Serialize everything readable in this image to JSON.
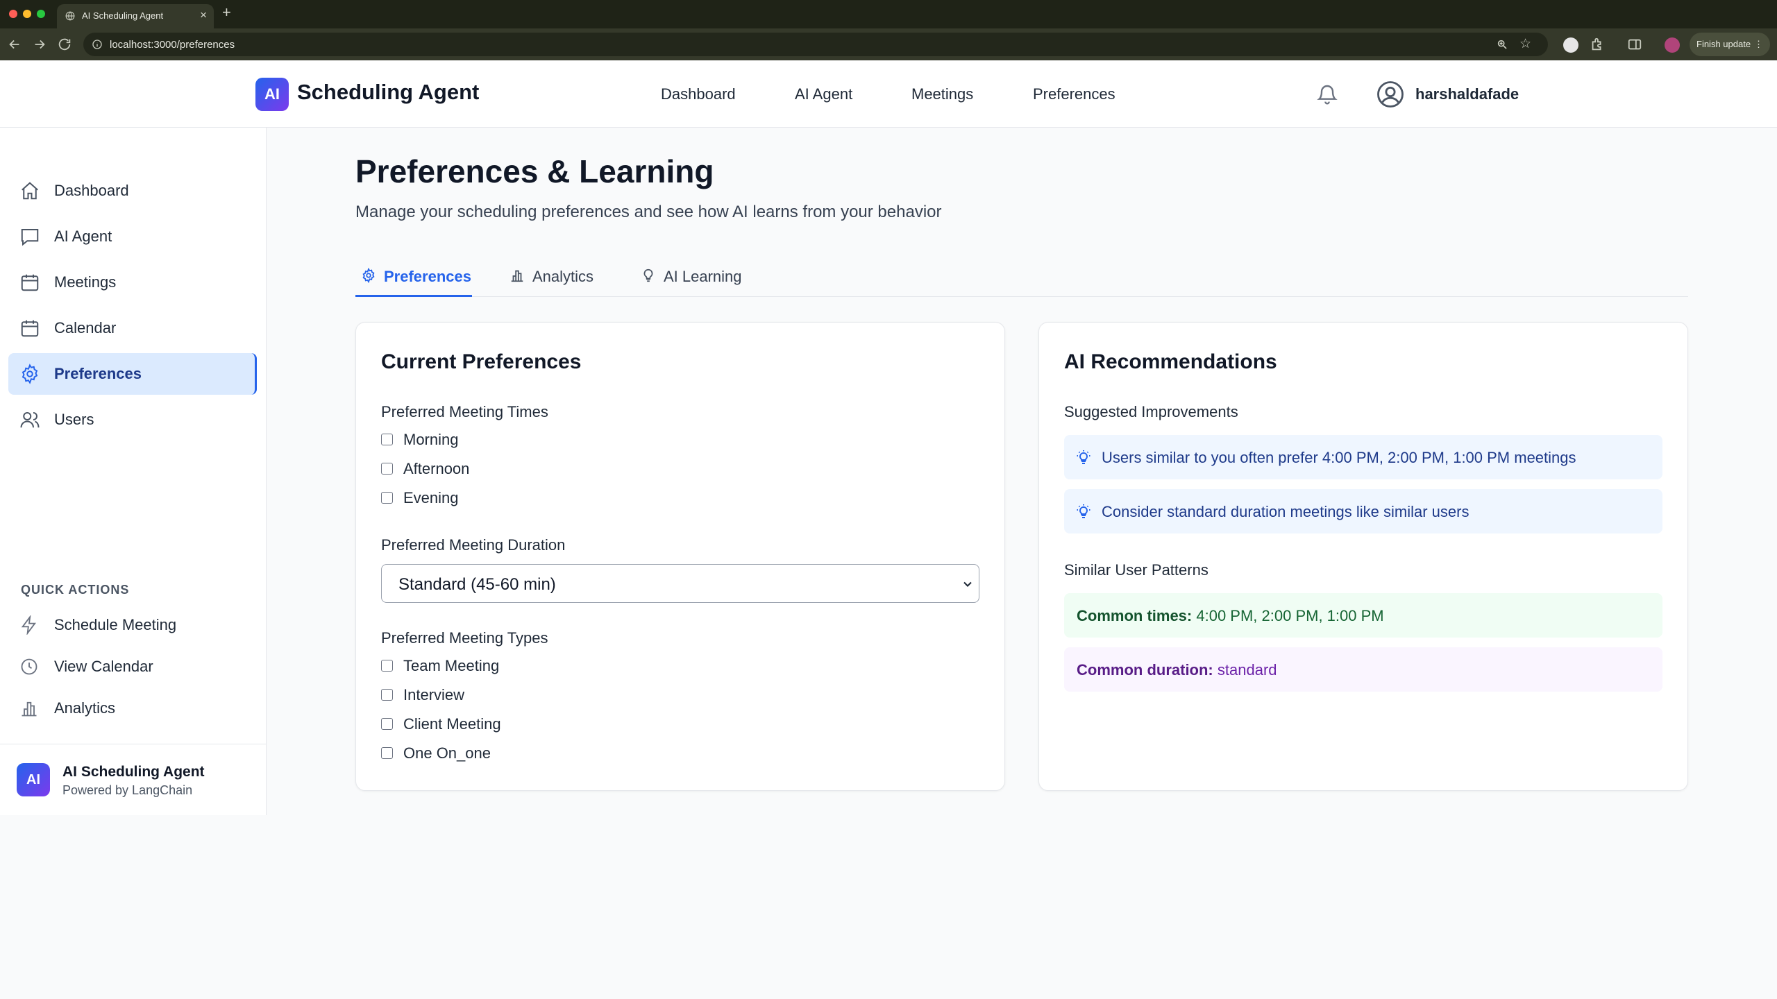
{
  "browser": {
    "tab_title": "AI Scheduling Agent",
    "url": "localhost:3000/preferences",
    "finish_update": "Finish update",
    "colors": {
      "red": "#ff5f57",
      "yellow": "#febc2e",
      "green": "#28c840"
    }
  },
  "header": {
    "logo_text": "AI",
    "brand": "Scheduling Agent",
    "nav": [
      "Dashboard",
      "AI Agent",
      "Meetings",
      "Preferences"
    ],
    "username": "harshaldafade"
  },
  "sidebar": {
    "items": [
      {
        "label": "Dashboard",
        "icon": "home-icon"
      },
      {
        "label": "AI Agent",
        "icon": "chat-icon"
      },
      {
        "label": "Meetings",
        "icon": "calendar-icon"
      },
      {
        "label": "Calendar",
        "icon": "calendar-icon"
      },
      {
        "label": "Preferences",
        "icon": "gear-icon",
        "active": true
      },
      {
        "label": "Users",
        "icon": "users-icon"
      }
    ],
    "quick_actions_title": "QUICK ACTIONS",
    "quick_actions": [
      {
        "label": "Schedule Meeting",
        "icon": "bolt-icon"
      },
      {
        "label": "View Calendar",
        "icon": "clock-icon"
      },
      {
        "label": "Analytics",
        "icon": "bar-chart-icon"
      }
    ],
    "footer": {
      "logo_text": "AI",
      "title": "AI Scheduling Agent",
      "subtitle": "Powered by LangChain"
    }
  },
  "main": {
    "title": "Preferences & Learning",
    "subtitle": "Manage your scheduling preferences and see how AI learns from your behavior",
    "tabs": [
      {
        "label": "Preferences",
        "icon": "gear-icon",
        "active": true
      },
      {
        "label": "Analytics",
        "icon": "bar-chart-icon"
      },
      {
        "label": "AI Learning",
        "icon": "lightbulb-icon"
      }
    ]
  },
  "current_preferences": {
    "title": "Current Preferences",
    "times_label": "Preferred Meeting Times",
    "times": [
      {
        "label": "Morning",
        "checked": false
      },
      {
        "label": "Afternoon",
        "checked": false
      },
      {
        "label": "Evening",
        "checked": false
      }
    ],
    "duration_label": "Preferred Meeting Duration",
    "duration_value": "Standard (45-60 min)",
    "types_label": "Preferred Meeting Types",
    "types": [
      {
        "label": "Team Meeting",
        "checked": false
      },
      {
        "label": "Interview",
        "checked": false
      },
      {
        "label": "Client Meeting",
        "checked": false
      },
      {
        "label": "One On_one",
        "checked": false
      }
    ]
  },
  "ai_recommendations": {
    "title": "AI Recommendations",
    "improvements_label": "Suggested Improvements",
    "improvements": [
      "Users similar to you often prefer 4:00 PM, 2:00 PM, 1:00 PM meetings",
      "Consider standard duration meetings like similar users"
    ],
    "patterns_label": "Similar User Patterns",
    "common_times_key": "Common times:",
    "common_times_value": "4:00 PM, 2:00 PM, 1:00 PM",
    "common_duration_key": "Common duration:",
    "common_duration_value": "standard"
  },
  "colors": {
    "accent": "#2563eb",
    "active_bg": "#dbeafe",
    "tip_bg": "#eff6ff",
    "green_bg": "#f0fdf4",
    "purple_bg": "#faf5ff"
  }
}
